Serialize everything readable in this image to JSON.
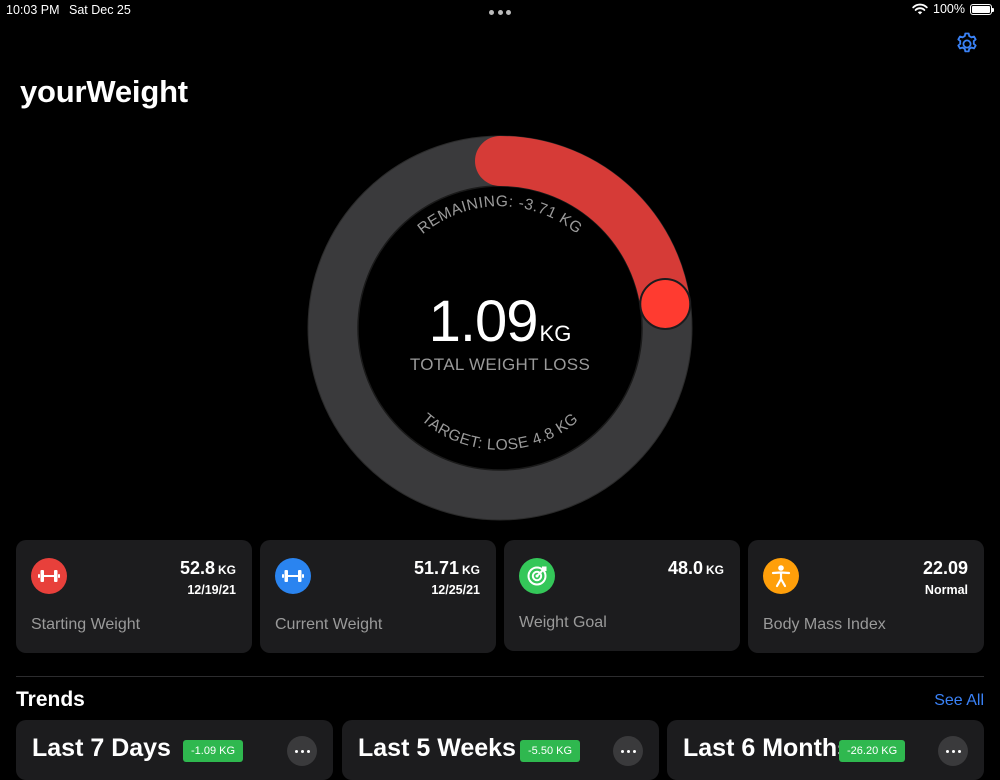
{
  "status_bar": {
    "time": "10:03 PM",
    "date": "Sat Dec 25",
    "battery": "100%"
  },
  "app": {
    "title": "yourWeight"
  },
  "progress": {
    "value": "1.09",
    "unit": "KG",
    "label": "TOTAL WEIGHT LOSS",
    "remaining": "REMAINING: -3.71 KG",
    "target": "TARGET: LOSE 4.8 KG",
    "fraction": 0.227,
    "accent_color": "#d63b37",
    "track_color": "#3a3a3c"
  },
  "cards": [
    {
      "value": "52.8",
      "unit": "KG",
      "sub": "12/19/21",
      "label": "Starting Weight",
      "icon": "dumbbell-icon",
      "color": "#e8403b"
    },
    {
      "value": "51.71",
      "unit": "KG",
      "sub": "12/25/21",
      "label": "Current Weight",
      "icon": "dumbbell-icon",
      "color": "#2a84f0"
    },
    {
      "value": "48.0",
      "unit": "KG",
      "sub": "",
      "label": "Weight Goal",
      "icon": "target-icon",
      "color": "#34c759"
    },
    {
      "value": "22.09",
      "unit": "",
      "sub": "Normal",
      "label": "Body Mass Index",
      "icon": "person-icon",
      "color": "#ff9f0a"
    }
  ],
  "trends": {
    "title": "Trends",
    "see_all": "See All",
    "items": [
      {
        "title": "Last 7 Days",
        "badge": "-1.09 KG"
      },
      {
        "title": "Last 5 Weeks",
        "badge": "-5.50 KG"
      },
      {
        "title": "Last 6 Months",
        "badge": "-26.20 KG"
      }
    ]
  }
}
